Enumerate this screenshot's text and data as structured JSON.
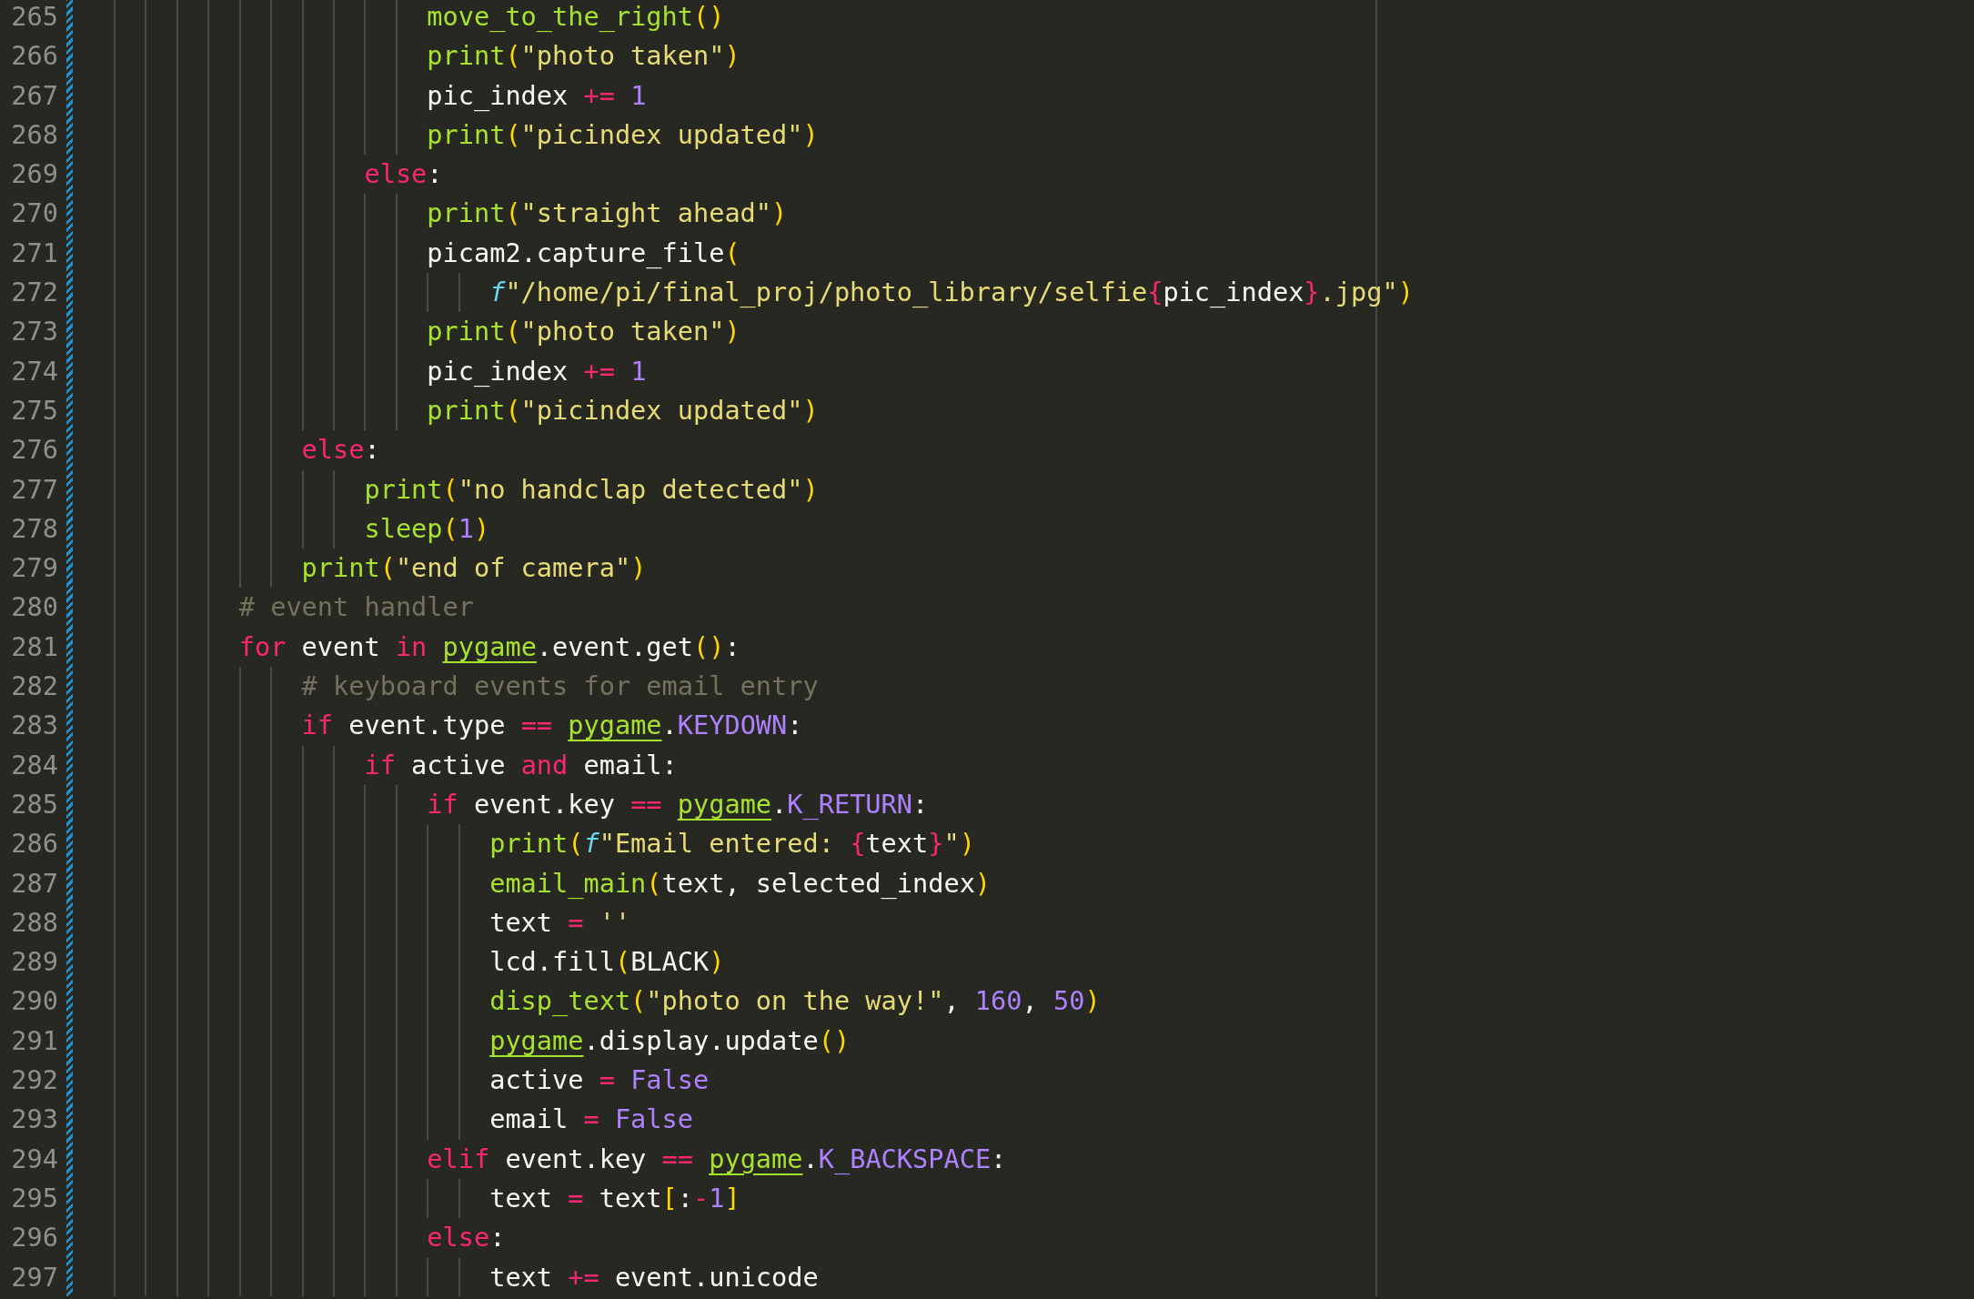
{
  "editor": {
    "lines": [
      {
        "number": "265",
        "tokens": [
          {
            "kind": "function",
            "text": "                    move_to_the_right"
          },
          {
            "kind": "bracket",
            "text": "()"
          }
        ]
      },
      {
        "number": "266",
        "tokens": [
          {
            "kind": "function",
            "text": "                    print"
          },
          {
            "kind": "bracket",
            "text": "("
          },
          {
            "kind": "string",
            "text": "\"photo taken\""
          },
          {
            "kind": "bracket",
            "text": ")"
          }
        ]
      },
      {
        "number": "267",
        "tokens": [
          {
            "kind": "plain",
            "text": "                    pic_index "
          },
          {
            "kind": "operator",
            "text": "+= "
          },
          {
            "kind": "number",
            "text": "1"
          }
        ]
      },
      {
        "number": "268",
        "tokens": [
          {
            "kind": "function",
            "text": "                    print"
          },
          {
            "kind": "bracket",
            "text": "("
          },
          {
            "kind": "string",
            "text": "\"picindex updated\""
          },
          {
            "kind": "bracket",
            "text": ")"
          }
        ]
      },
      {
        "number": "269",
        "tokens": [
          {
            "kind": "keyword",
            "text": "                else"
          },
          {
            "kind": "plain",
            "text": ":"
          }
        ]
      },
      {
        "number": "270",
        "tokens": [
          {
            "kind": "function",
            "text": "                    print"
          },
          {
            "kind": "bracket",
            "text": "("
          },
          {
            "kind": "string",
            "text": "\"straight ahead\""
          },
          {
            "kind": "bracket",
            "text": ")"
          }
        ]
      },
      {
        "number": "271",
        "tokens": [
          {
            "kind": "plain",
            "text": "                    picam2.capture_file"
          },
          {
            "kind": "bracket",
            "text": "("
          }
        ]
      },
      {
        "number": "272",
        "tokens": [
          {
            "kind": "fprefix",
            "text": "                        f"
          },
          {
            "kind": "string",
            "text": "\"/home/pi/final_proj/photo_library/selfie"
          },
          {
            "kind": "brace",
            "text": "{"
          },
          {
            "kind": "plain",
            "text": "pic_index"
          },
          {
            "kind": "brace",
            "text": "}"
          },
          {
            "kind": "string",
            "text": ".jpg\""
          },
          {
            "kind": "bracket",
            "text": ")"
          }
        ]
      },
      {
        "number": "273",
        "tokens": [
          {
            "kind": "function",
            "text": "                    print"
          },
          {
            "kind": "bracket",
            "text": "("
          },
          {
            "kind": "string",
            "text": "\"photo taken\""
          },
          {
            "kind": "bracket",
            "text": ")"
          }
        ]
      },
      {
        "number": "274",
        "tokens": [
          {
            "kind": "plain",
            "text": "                    pic_index "
          },
          {
            "kind": "operator",
            "text": "+= "
          },
          {
            "kind": "number",
            "text": "1"
          }
        ]
      },
      {
        "number": "275",
        "tokens": [
          {
            "kind": "function",
            "text": "                    print"
          },
          {
            "kind": "bracket",
            "text": "("
          },
          {
            "kind": "string",
            "text": "\"picindex updated\""
          },
          {
            "kind": "bracket",
            "text": ")"
          }
        ]
      },
      {
        "number": "276",
        "tokens": [
          {
            "kind": "keyword",
            "text": "            else"
          },
          {
            "kind": "plain",
            "text": ":"
          }
        ]
      },
      {
        "number": "277",
        "tokens": [
          {
            "kind": "function",
            "text": "                print"
          },
          {
            "kind": "bracket",
            "text": "("
          },
          {
            "kind": "string",
            "text": "\"no handclap detected\""
          },
          {
            "kind": "bracket",
            "text": ")"
          }
        ]
      },
      {
        "number": "278",
        "tokens": [
          {
            "kind": "function",
            "text": "                sleep"
          },
          {
            "kind": "bracket",
            "text": "("
          },
          {
            "kind": "number",
            "text": "1"
          },
          {
            "kind": "bracket",
            "text": ")"
          }
        ]
      },
      {
        "number": "279",
        "tokens": [
          {
            "kind": "function",
            "text": "            print"
          },
          {
            "kind": "bracket",
            "text": "("
          },
          {
            "kind": "string",
            "text": "\"end of camera\""
          },
          {
            "kind": "bracket",
            "text": ")"
          }
        ]
      },
      {
        "number": "280",
        "tokens": [
          {
            "kind": "comment",
            "text": "        # event handler"
          }
        ]
      },
      {
        "number": "281",
        "tokens": [
          {
            "kind": "keyword",
            "text": "        for"
          },
          {
            "kind": "plain",
            "text": " event "
          },
          {
            "kind": "keyword",
            "text": "in "
          },
          {
            "kind": "module",
            "text": "pygame"
          },
          {
            "kind": "plain",
            "text": ".event.get"
          },
          {
            "kind": "bracket",
            "text": "()"
          },
          {
            "kind": "plain",
            "text": ":"
          }
        ]
      },
      {
        "number": "282",
        "tokens": [
          {
            "kind": "comment",
            "text": "            # keyboard events for email entry"
          }
        ]
      },
      {
        "number": "283",
        "tokens": [
          {
            "kind": "keyword",
            "text": "            if"
          },
          {
            "kind": "plain",
            "text": " event.type "
          },
          {
            "kind": "operator",
            "text": "== "
          },
          {
            "kind": "module",
            "text": "pygame"
          },
          {
            "kind": "plain",
            "text": "."
          },
          {
            "kind": "constant",
            "text": "KEYDOWN"
          },
          {
            "kind": "plain",
            "text": ":"
          }
        ]
      },
      {
        "number": "284",
        "tokens": [
          {
            "kind": "keyword",
            "text": "                if"
          },
          {
            "kind": "plain",
            "text": " active "
          },
          {
            "kind": "keyword",
            "text": "and"
          },
          {
            "kind": "plain",
            "text": " email:"
          }
        ]
      },
      {
        "number": "285",
        "tokens": [
          {
            "kind": "keyword",
            "text": "                    if"
          },
          {
            "kind": "plain",
            "text": " event.key "
          },
          {
            "kind": "operator",
            "text": "== "
          },
          {
            "kind": "module",
            "text": "pygame"
          },
          {
            "kind": "plain",
            "text": "."
          },
          {
            "kind": "constant",
            "text": "K_RETURN"
          },
          {
            "kind": "plain",
            "text": ":"
          }
        ]
      },
      {
        "number": "286",
        "tokens": [
          {
            "kind": "function",
            "text": "                        print"
          },
          {
            "kind": "bracket",
            "text": "("
          },
          {
            "kind": "fprefix",
            "text": "f"
          },
          {
            "kind": "string",
            "text": "\"Email entered: "
          },
          {
            "kind": "brace",
            "text": "{"
          },
          {
            "kind": "plain",
            "text": "text"
          },
          {
            "kind": "brace",
            "text": "}"
          },
          {
            "kind": "string",
            "text": "\""
          },
          {
            "kind": "bracket",
            "text": ")"
          }
        ]
      },
      {
        "number": "287",
        "tokens": [
          {
            "kind": "function",
            "text": "                        email_main"
          },
          {
            "kind": "bracket",
            "text": "("
          },
          {
            "kind": "plain",
            "text": "text, selected_index"
          },
          {
            "kind": "bracket",
            "text": ")"
          }
        ]
      },
      {
        "number": "288",
        "tokens": [
          {
            "kind": "plain",
            "text": "                        text "
          },
          {
            "kind": "operator",
            "text": "= "
          },
          {
            "kind": "string",
            "text": "''"
          }
        ]
      },
      {
        "number": "289",
        "tokens": [
          {
            "kind": "plain",
            "text": "                        lcd.fill"
          },
          {
            "kind": "bracket",
            "text": "("
          },
          {
            "kind": "plain",
            "text": "BLACK"
          },
          {
            "kind": "bracket",
            "text": ")"
          }
        ]
      },
      {
        "number": "290",
        "tokens": [
          {
            "kind": "function",
            "text": "                        disp_text"
          },
          {
            "kind": "bracket",
            "text": "("
          },
          {
            "kind": "string",
            "text": "\"photo on the way!\""
          },
          {
            "kind": "plain",
            "text": ", "
          },
          {
            "kind": "number",
            "text": "160"
          },
          {
            "kind": "plain",
            "text": ", "
          },
          {
            "kind": "number",
            "text": "50"
          },
          {
            "kind": "bracket",
            "text": ")"
          }
        ]
      },
      {
        "number": "291",
        "tokens": [
          {
            "kind": "module",
            "text": "                        pygame"
          },
          {
            "kind": "plain",
            "text": ".display.update"
          },
          {
            "kind": "bracket",
            "text": "()"
          }
        ]
      },
      {
        "number": "292",
        "tokens": [
          {
            "kind": "plain",
            "text": "                        active "
          },
          {
            "kind": "operator",
            "text": "= "
          },
          {
            "kind": "constant",
            "text": "False"
          }
        ]
      },
      {
        "number": "293",
        "tokens": [
          {
            "kind": "plain",
            "text": "                        email "
          },
          {
            "kind": "operator",
            "text": "= "
          },
          {
            "kind": "constant",
            "text": "False"
          }
        ]
      },
      {
        "number": "294",
        "tokens": [
          {
            "kind": "keyword",
            "text": "                    elif"
          },
          {
            "kind": "plain",
            "text": " event.key "
          },
          {
            "kind": "operator",
            "text": "== "
          },
          {
            "kind": "module",
            "text": "pygame"
          },
          {
            "kind": "plain",
            "text": "."
          },
          {
            "kind": "constant",
            "text": "K_BACKSPACE"
          },
          {
            "kind": "plain",
            "text": ":"
          }
        ]
      },
      {
        "number": "295",
        "tokens": [
          {
            "kind": "plain",
            "text": "                        text "
          },
          {
            "kind": "operator",
            "text": "="
          },
          {
            "kind": "plain",
            "text": " text"
          },
          {
            "kind": "bracket",
            "text": "["
          },
          {
            "kind": "plain",
            "text": ":"
          },
          {
            "kind": "operator",
            "text": "-"
          },
          {
            "kind": "number",
            "text": "1"
          },
          {
            "kind": "bracket",
            "text": "]"
          }
        ]
      },
      {
        "number": "296",
        "tokens": [
          {
            "kind": "keyword",
            "text": "                    else"
          },
          {
            "kind": "plain",
            "text": ":"
          }
        ]
      },
      {
        "number": "297",
        "tokens": [
          {
            "kind": "plain",
            "text": "                        text "
          },
          {
            "kind": "operator",
            "text": "+="
          },
          {
            "kind": "plain",
            "text": " event.unicode"
          }
        ]
      }
    ]
  }
}
